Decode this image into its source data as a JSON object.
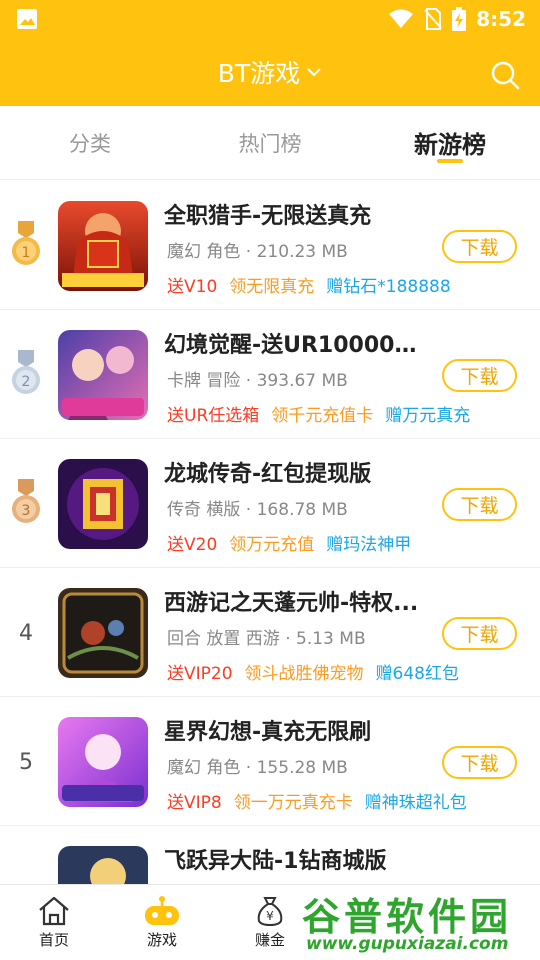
{
  "status_bar": {
    "time": "8:52"
  },
  "header": {
    "title": "BT游戏"
  },
  "tabs": [
    {
      "label": "分类",
      "active": false
    },
    {
      "label": "热门榜",
      "active": false
    },
    {
      "label": "新游榜",
      "active": true
    }
  ],
  "games": [
    {
      "rank": "1",
      "rank_type": "gold",
      "title": "全职猎手-无限送真充",
      "meta": "魔幻 角色 · 210.23 MB",
      "perks": [
        "送V10",
        "领无限真充",
        "赠钻石*188888"
      ],
      "download_label": "下载"
    },
    {
      "rank": "2",
      "rank_type": "silver",
      "title": "幻境觉醒-送UR10000真充",
      "meta": "卡牌 冒险 · 393.67 MB",
      "perks": [
        "送UR任选箱",
        "领千元充值卡",
        "赠万元真充"
      ],
      "download_label": "下载"
    },
    {
      "rank": "3",
      "rank_type": "bronze",
      "title": "龙城传奇-红包提现版",
      "meta": "传奇 横版 · 168.78 MB",
      "perks": [
        "送V20",
        "领万元充值",
        "赠玛法神甲"
      ],
      "download_label": "下载"
    },
    {
      "rank": "4",
      "rank_type": "number",
      "title": "西游记之天蓬元帅-特权...",
      "meta": "回合 放置 西游 · 5.13 MB",
      "perks": [
        "送VIP20",
        "领斗战胜佛宠物",
        "赠648红包"
      ],
      "download_label": "下载"
    },
    {
      "rank": "5",
      "rank_type": "number",
      "title": "星界幻想-真充无限刷",
      "meta": "魔幻 角色 · 155.28 MB",
      "perks": [
        "送VIP8",
        "领一万元真充卡",
        "赠神珠超礼包"
      ],
      "download_label": "下载"
    },
    {
      "rank": "6",
      "rank_type": "number",
      "title": "飞跃异大陆-1钻商城版",
      "meta": "",
      "perks": [],
      "download_label": ""
    }
  ],
  "bottom_nav": [
    {
      "label": "首页",
      "icon": "home-icon"
    },
    {
      "label": "游戏",
      "icon": "gamepad-icon"
    },
    {
      "label": "赚金",
      "icon": "money-bag-icon"
    }
  ],
  "watermark": {
    "text": "谷普软件园",
    "url": "www.gupuxiazai.com"
  },
  "colors": {
    "brand": "#FFC30F",
    "perk_red": "#FF3B22",
    "perk_orange": "#FF9B21",
    "perk_blue": "#1AA7E8"
  }
}
